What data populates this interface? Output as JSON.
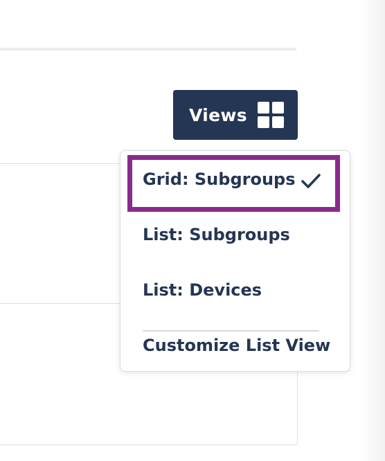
{
  "toolbar": {
    "views_label": "Views",
    "views_icon": "grid-icon"
  },
  "views_menu": {
    "items": [
      {
        "label": "Grid: Subgroups",
        "selected": true,
        "icon": "check-icon"
      },
      {
        "label": "List: Subgroups",
        "selected": false
      },
      {
        "label": "List: Devices",
        "selected": false
      }
    ],
    "footer_action": {
      "label": "Customize List View"
    }
  },
  "colors": {
    "button_bg": "#253554",
    "menu_text": "#253554",
    "highlight_border": "#8a2a8f"
  }
}
